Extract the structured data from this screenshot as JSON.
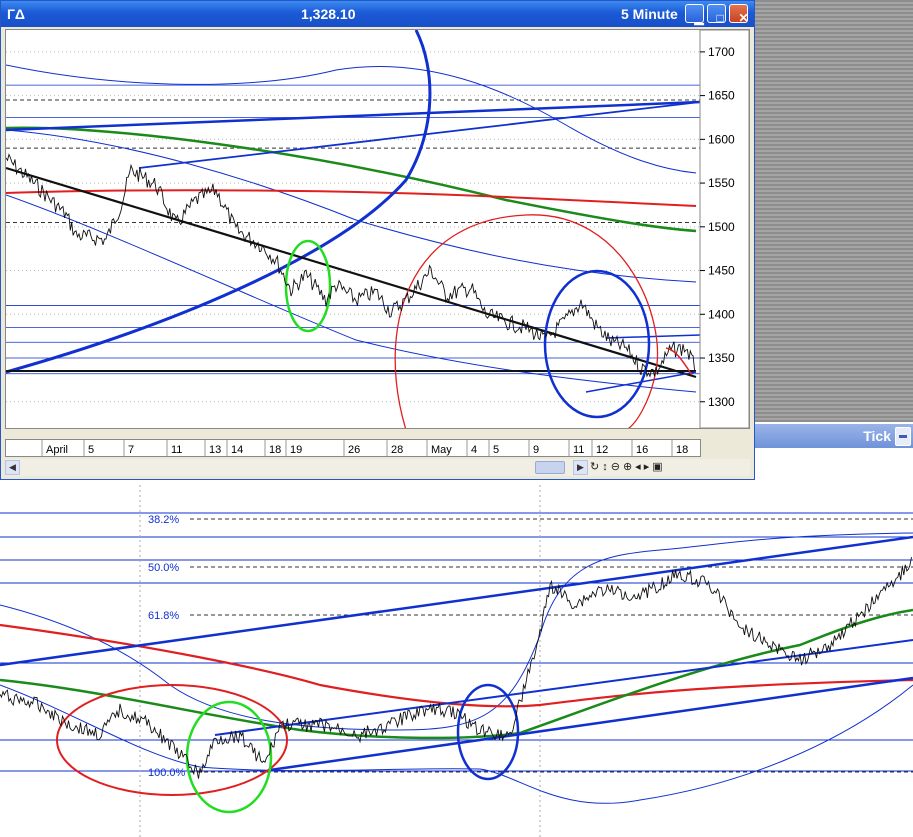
{
  "window": {
    "title": "ГΔ",
    "price": "1,328.10",
    "interval": "5 Minute"
  },
  "side_panel": {
    "label": "Tick"
  },
  "chart_data": [
    {
      "type": "line",
      "y_ticks": [
        1300,
        1350,
        1400,
        1450,
        1500,
        1550,
        1600,
        1650,
        1700
      ],
      "ylim": [
        1270,
        1725
      ],
      "x_labels": [
        "April",
        "5",
        "7",
        "11",
        "13",
        "14",
        "18",
        "19",
        "26",
        "28",
        "May",
        "4",
        "5",
        "9",
        "11",
        "12",
        "16",
        "18"
      ],
      "last_value": 1328.1
    },
    {
      "type": "line",
      "fib_levels": [
        "38.2%",
        "50.0%",
        "61.8%",
        "100.0%"
      ]
    }
  ],
  "colors": {
    "ma_green": "#1a8a1a",
    "ma_red": "#e02020",
    "trend_blue": "#1030d0",
    "circle_green": "#22dd22"
  }
}
